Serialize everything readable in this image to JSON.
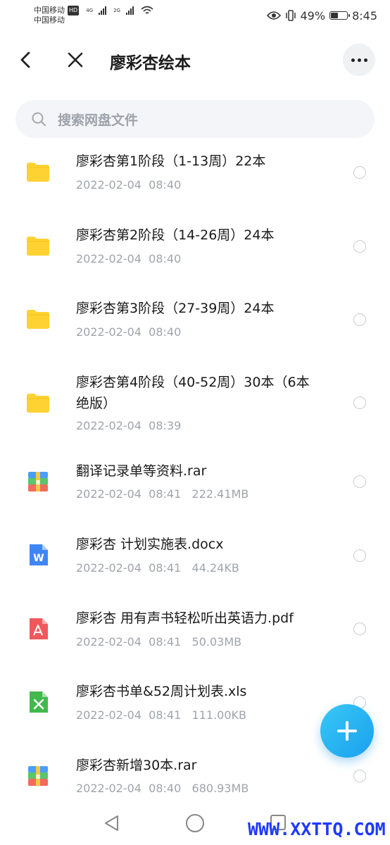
{
  "status_bar": {
    "carrier_1": "中国移动",
    "carrier_2": "中国移动",
    "hd": "HD",
    "net_1": "4G",
    "net_2": "2G",
    "battery_percent": "49%",
    "battery_level": 0.49,
    "time": "8:45"
  },
  "header": {
    "title": "廖彩杏绘本"
  },
  "search": {
    "placeholder": "搜索网盘文件"
  },
  "files": [
    {
      "name": "廖彩杏第1阶段（1-13周）22本",
      "meta": "2022-02-04  08:40",
      "icon": "folder-icon"
    },
    {
      "name": "廖彩杏第2阶段（14-26周）24本",
      "meta": "2022-02-04  08:40",
      "icon": "folder-icon"
    },
    {
      "name": "廖彩杏第3阶段（27-39周）24本",
      "meta": "2022-02-04  08:40",
      "icon": "folder-icon"
    },
    {
      "name": "廖彩杏第4阶段（40-52周）30本（6本绝版）",
      "meta": "2022-02-04  08:39",
      "icon": "folder-icon"
    },
    {
      "name": "翻译记录单等资料.rar",
      "meta": "2022-02-04  08:41   222.41MB",
      "icon": "archive-icon"
    },
    {
      "name": "廖彩杏 计划实施表.docx",
      "meta": "2022-02-04  08:41   44.24KB",
      "icon": "word-icon"
    },
    {
      "name": "廖彩杏 用有声书轻松听出英语力.pdf",
      "meta": "2022-02-04  08:41   50.03MB",
      "icon": "pdf-icon"
    },
    {
      "name": "廖彩杏书单&52周计划表.xls",
      "meta": "2022-02-04  08:41   111.00KB",
      "icon": "excel-icon"
    },
    {
      "name": "廖彩杏新增30本.rar",
      "meta": "2022-02-04  08:40   680.93MB",
      "icon": "archive-icon"
    }
  ],
  "watermark": "WWW.XXTTQ.COM",
  "colors": {
    "folder": "#ffd233",
    "word": "#3f86f5",
    "pdf": "#f0595b",
    "excel": "#43b84d",
    "fab": "#1aa0ee",
    "watermark": "#1f39ff"
  }
}
